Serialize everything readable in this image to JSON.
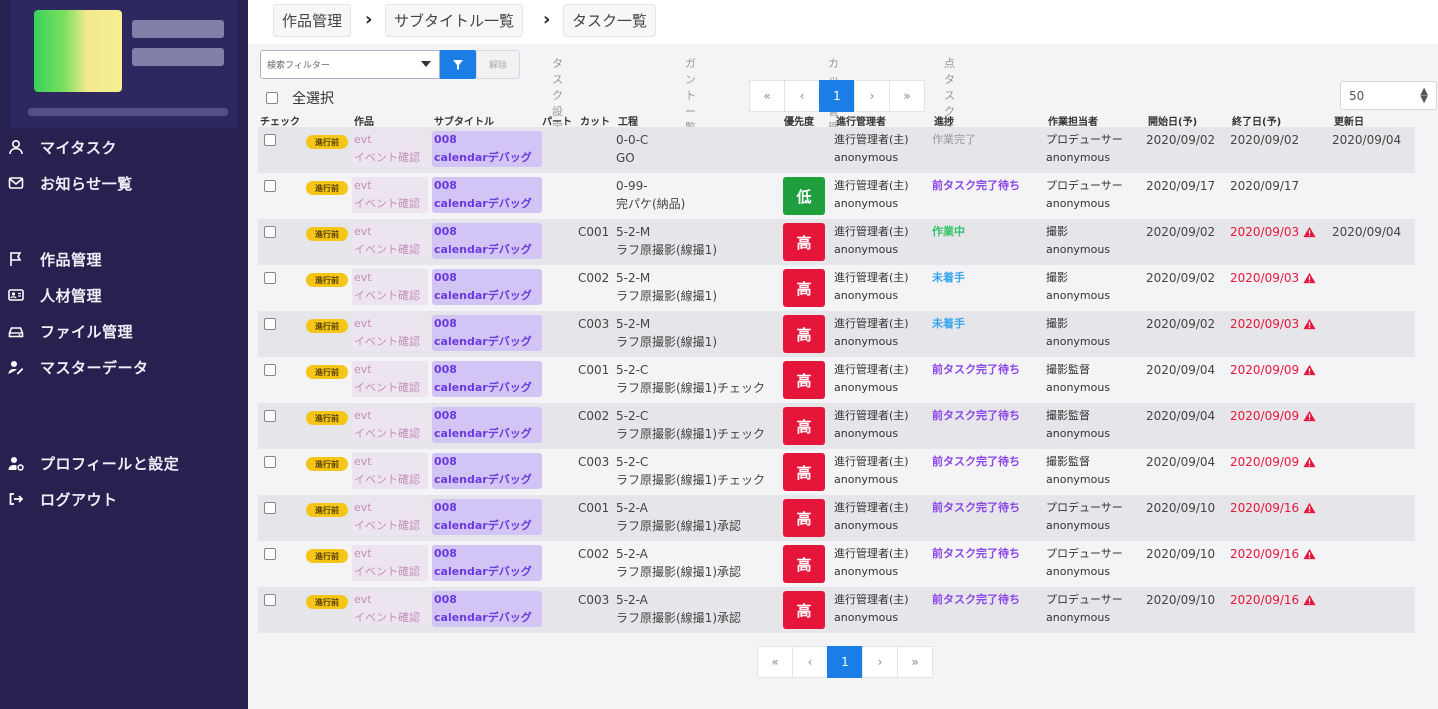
{
  "sidebar": {
    "nav": [
      {
        "label": "マイタスク",
        "icon": "user-icon"
      },
      {
        "label": "お知らせ一覧",
        "icon": "mail-icon"
      },
      {
        "label": "作品管理",
        "icon": "flag-icon"
      },
      {
        "label": "人材管理",
        "icon": "id-card-icon"
      },
      {
        "label": "ファイル管理",
        "icon": "drive-icon"
      },
      {
        "label": "マスターデータ",
        "icon": "user-edit-icon"
      },
      {
        "label": "プロフィールと設定",
        "icon": "user-cog-icon"
      },
      {
        "label": "ログアウト",
        "icon": "sign-out-icon"
      }
    ]
  },
  "breadcrumb": [
    "作品管理",
    "サブタイトル一覧",
    "タスク一覧"
  ],
  "toolbar": {
    "filter_placeholder": "検索フィルター",
    "clear_label": "解除",
    "links": [
      "タスク設定",
      "ガントー覧",
      "カット管理",
      "点タスク オン/オフ"
    ]
  },
  "select_all_label": "全選択",
  "pagination": {
    "first": "«",
    "prev": "‹",
    "current": "1",
    "next": "›",
    "last": "»"
  },
  "per_page": "50",
  "table": {
    "headers": [
      "チェック",
      "作品",
      "サブタイトル",
      "パート",
      "カット",
      "工程",
      "優先度",
      "進行管理者",
      "進捗",
      "作業担当者",
      "開始日(予)",
      "終了日(予)",
      "更新日"
    ],
    "rows": [
      {
        "badge": "進行前",
        "work": "evt",
        "work2": "イベント確認",
        "sub1": "008",
        "sub2": "calendarデバッグ",
        "cut": "",
        "proc1": "0-0-C",
        "proc2": "GO",
        "prio": "",
        "mgr1": "進行管理者(主)",
        "mgr2": "anonymous",
        "status": "作業完了",
        "status_type": "done",
        "lead1": "プロデューサー",
        "lead2": "anonymous",
        "start": "2020/09/02",
        "end": "2020/09/02",
        "end_late": false,
        "updated": "2020/09/04"
      },
      {
        "badge": "進行前",
        "work": "evt",
        "work2": "イベント確認",
        "sub1": "008",
        "sub2": "calendarデバッグ",
        "cut": "",
        "proc1": "0-99-",
        "proc2": "完パケ(納品)",
        "prio": "低",
        "mgr1": "進行管理者(主)",
        "mgr2": "anonymous",
        "status": "前タスク完了待ち",
        "status_type": "waiting",
        "lead1": "プロデューサー",
        "lead2": "anonymous",
        "start": "2020/09/17",
        "end": "2020/09/17",
        "end_late": false,
        "updated": ""
      },
      {
        "badge": "進行前",
        "work": "evt",
        "work2": "イベント確認",
        "sub1": "008",
        "sub2": "calendarデバッグ",
        "cut": "C001",
        "proc1": "5-2-M",
        "proc2": "ラフ原撮影(線撮1)",
        "prio": "高",
        "mgr1": "進行管理者(主)",
        "mgr2": "anonymous",
        "status": "作業中",
        "status_type": "progress",
        "lead1": "撮影",
        "lead2": "anonymous",
        "start": "2020/09/02",
        "end": "2020/09/03",
        "end_late": true,
        "updated": "2020/09/04"
      },
      {
        "badge": "進行前",
        "work": "evt",
        "work2": "イベント確認",
        "sub1": "008",
        "sub2": "calendarデバッグ",
        "cut": "C002",
        "proc1": "5-2-M",
        "proc2": "ラフ原撮影(線撮1)",
        "prio": "高",
        "mgr1": "進行管理者(主)",
        "mgr2": "anonymous",
        "status": "未着手",
        "status_type": "notstarted",
        "lead1": "撮影",
        "lead2": "anonymous",
        "start": "2020/09/02",
        "end": "2020/09/03",
        "end_late": true,
        "updated": ""
      },
      {
        "badge": "進行前",
        "work": "evt",
        "work2": "イベント確認",
        "sub1": "008",
        "sub2": "calendarデバッグ",
        "cut": "C003",
        "proc1": "5-2-M",
        "proc2": "ラフ原撮影(線撮1)",
        "prio": "高",
        "mgr1": "進行管理者(主)",
        "mgr2": "anonymous",
        "status": "未着手",
        "status_type": "notstarted",
        "lead1": "撮影",
        "lead2": "anonymous",
        "start": "2020/09/02",
        "end": "2020/09/03",
        "end_late": true,
        "updated": ""
      },
      {
        "badge": "進行前",
        "work": "evt",
        "work2": "イベント確認",
        "sub1": "008",
        "sub2": "calendarデバッグ",
        "cut": "C001",
        "proc1": "5-2-C",
        "proc2": "ラフ原撮影(線撮1)チェック",
        "prio": "高",
        "mgr1": "進行管理者(主)",
        "mgr2": "anonymous",
        "status": "前タスク完了待ち",
        "status_type": "waiting",
        "lead1": "撮影監督",
        "lead2": "anonymous",
        "start": "2020/09/04",
        "end": "2020/09/09",
        "end_late": true,
        "updated": ""
      },
      {
        "badge": "進行前",
        "work": "evt",
        "work2": "イベント確認",
        "sub1": "008",
        "sub2": "calendarデバッグ",
        "cut": "C002",
        "proc1": "5-2-C",
        "proc2": "ラフ原撮影(線撮1)チェック",
        "prio": "高",
        "mgr1": "進行管理者(主)",
        "mgr2": "anonymous",
        "status": "前タスク完了待ち",
        "status_type": "waiting",
        "lead1": "撮影監督",
        "lead2": "anonymous",
        "start": "2020/09/04",
        "end": "2020/09/09",
        "end_late": true,
        "updated": ""
      },
      {
        "badge": "進行前",
        "work": "evt",
        "work2": "イベント確認",
        "sub1": "008",
        "sub2": "calendarデバッグ",
        "cut": "C003",
        "proc1": "5-2-C",
        "proc2": "ラフ原撮影(線撮1)チェック",
        "prio": "高",
        "mgr1": "進行管理者(主)",
        "mgr2": "anonymous",
        "status": "前タスク完了待ち",
        "status_type": "waiting",
        "lead1": "撮影監督",
        "lead2": "anonymous",
        "start": "2020/09/04",
        "end": "2020/09/09",
        "end_late": true,
        "updated": ""
      },
      {
        "badge": "進行前",
        "work": "evt",
        "work2": "イベント確認",
        "sub1": "008",
        "sub2": "calendarデバッグ",
        "cut": "C001",
        "proc1": "5-2-A",
        "proc2": "ラフ原撮影(線撮1)承認",
        "prio": "高",
        "mgr1": "進行管理者(主)",
        "mgr2": "anonymous",
        "status": "前タスク完了待ち",
        "status_type": "waiting",
        "lead1": "プロデューサー",
        "lead2": "anonymous",
        "start": "2020/09/10",
        "end": "2020/09/16",
        "end_late": true,
        "updated": ""
      },
      {
        "badge": "進行前",
        "work": "evt",
        "work2": "イベント確認",
        "sub1": "008",
        "sub2": "calendarデバッグ",
        "cut": "C002",
        "proc1": "5-2-A",
        "proc2": "ラフ原撮影(線撮1)承認",
        "prio": "高",
        "mgr1": "進行管理者(主)",
        "mgr2": "anonymous",
        "status": "前タスク完了待ち",
        "status_type": "waiting",
        "lead1": "プロデューサー",
        "lead2": "anonymous",
        "start": "2020/09/10",
        "end": "2020/09/16",
        "end_late": true,
        "updated": ""
      },
      {
        "badge": "進行前",
        "work": "evt",
        "work2": "イベント確認",
        "sub1": "008",
        "sub2": "calendarデバッグ",
        "cut": "C003",
        "proc1": "5-2-A",
        "proc2": "ラフ原撮影(線撮1)承認",
        "prio": "高",
        "mgr1": "進行管理者(主)",
        "mgr2": "anonymous",
        "status": "前タスク完了待ち",
        "status_type": "waiting",
        "lead1": "プロデューサー",
        "lead2": "anonymous",
        "start": "2020/09/10",
        "end": "2020/09/16",
        "end_late": true,
        "updated": ""
      }
    ]
  }
}
